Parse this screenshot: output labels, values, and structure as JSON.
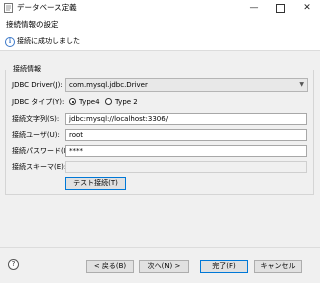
{
  "window": {
    "title": "データベース定義",
    "minimize_icon": "minimize-icon",
    "maximize_icon": "maximize-icon",
    "close_icon": "close-icon"
  },
  "header": {
    "title": "接続情報の設定",
    "message": "接続に成功しました",
    "message_icon": "info-icon"
  },
  "group": {
    "title": "接続情報"
  },
  "form": {
    "driver_label": "JDBC Driver(J):",
    "driver_value": "com.mysql.jdbc.Driver",
    "type_label": "JDBC タイプ(Y):",
    "type_options": [
      "Type4",
      "Type 2"
    ],
    "type_selected": "Type4",
    "url_label": "接続文字列(S):",
    "url_value": "jdbc:mysql://localhost:3306/",
    "user_label": "接続ユーザ(U):",
    "user_value": "root",
    "password_label": "接続パスワード(P):",
    "password_value": "****",
    "schema_label": "接続スキーマ(E):",
    "schema_value": "",
    "test_button": "テスト接続(T)"
  },
  "footer": {
    "help_icon": "help-icon",
    "back_button": "< 戻る(B)",
    "next_button": "次へ(N) >",
    "finish_button": "完了(F)",
    "cancel_button": "キャンセル"
  }
}
